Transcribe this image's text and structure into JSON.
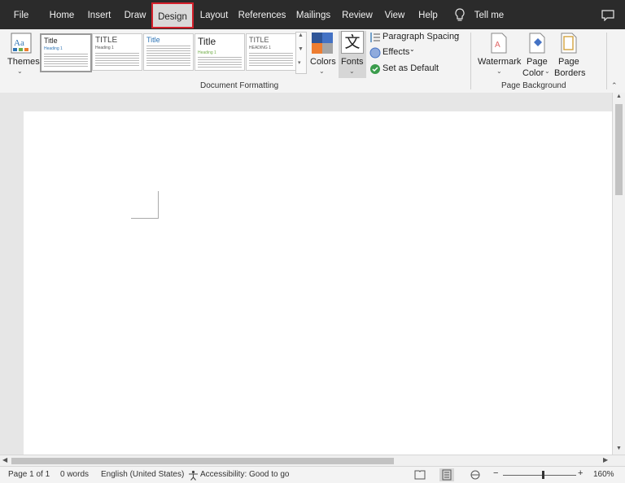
{
  "tabs": [
    "File",
    "Home",
    "Insert",
    "Draw",
    "Design",
    "Layout",
    "References",
    "Mailings",
    "Review",
    "View",
    "Help"
  ],
  "active_tab": "Design",
  "tell_me": "Tell me",
  "ribbon": {
    "themes_label": "Themes",
    "style_thumbs": [
      {
        "title": "Title",
        "heading": "Heading 1"
      },
      {
        "title": "TITLE",
        "heading": "Heading 1"
      },
      {
        "title": "Title",
        "heading": ""
      },
      {
        "title": "Title",
        "heading": "Heading 1"
      },
      {
        "title": "TITLE",
        "heading": "HEADING 1"
      }
    ],
    "colors_label": "Colors",
    "fonts_label": "Fonts",
    "fonts_glyph": "文",
    "paragraph_spacing_label": "Paragraph Spacing",
    "effects_label": "Effects",
    "set_default_label": "Set as Default",
    "group_document_formatting": "Document Formatting",
    "watermark_label": "Watermark",
    "page_color_label1": "Page",
    "page_color_label2": "Color",
    "page_borders_label1": "Page",
    "page_borders_label2": "Borders",
    "group_page_background": "Page Background"
  },
  "status": {
    "page": "Page 1 of 1",
    "words": "0 words",
    "language": "English (United States)",
    "accessibility": "Accessibility: Good to go",
    "zoom": "160%"
  },
  "colors": {
    "accent_red": "#d4202b",
    "titlebar": "#2b2b2b"
  }
}
